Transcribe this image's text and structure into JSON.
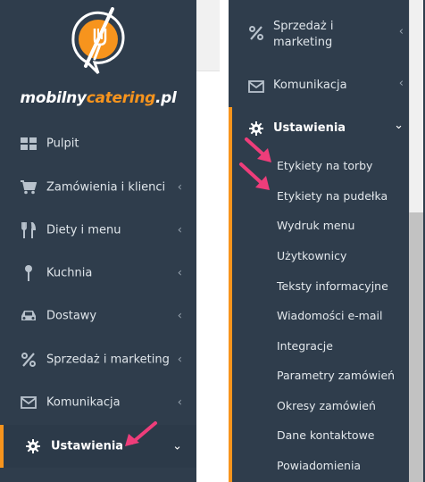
{
  "brand": {
    "part1": "mobilny",
    "part2": "catering",
    "part3": ".pl",
    "accent_color": "#f7941d",
    "sidebar_color": "#2f3d4c"
  },
  "left_nav": [
    {
      "label": "Pulpit",
      "icon": "dashboard-icon",
      "chevron": ""
    },
    {
      "label": "Zamówienia i klienci",
      "icon": "cart-icon",
      "chevron": "‹"
    },
    {
      "label": "Diety i menu",
      "icon": "utensils-icon",
      "chevron": "‹"
    },
    {
      "label": "Kuchnia",
      "icon": "spoon-icon",
      "chevron": "‹"
    },
    {
      "label": "Dostawy",
      "icon": "car-icon",
      "chevron": "‹"
    },
    {
      "label": "Sprzedaż i marketing",
      "icon": "percent-icon",
      "chevron": "‹"
    },
    {
      "label": "Komunikacja",
      "icon": "envelope-icon",
      "chevron": "‹"
    },
    {
      "label": "Ustawienia",
      "icon": "gear-icon",
      "chevron": "⌄"
    }
  ],
  "right_nav": {
    "marketing_line1": "Sprzedaż i",
    "marketing_line2": "marketing",
    "communication": "Komunikacja",
    "settings": "Ustawienia",
    "chev_left": "‹",
    "chev_down": "⌄",
    "submenu": [
      "Etykiety na torby",
      "Etykiety na pudełka",
      "Wydruk menu",
      "Użytkownicy",
      "Teksty informacyjne",
      "Wiadomości e-mail",
      "Integracje",
      "Parametry zamówień",
      "Okresy zamówień",
      "Dane kontaktowe",
      "Powiadomienia"
    ]
  }
}
